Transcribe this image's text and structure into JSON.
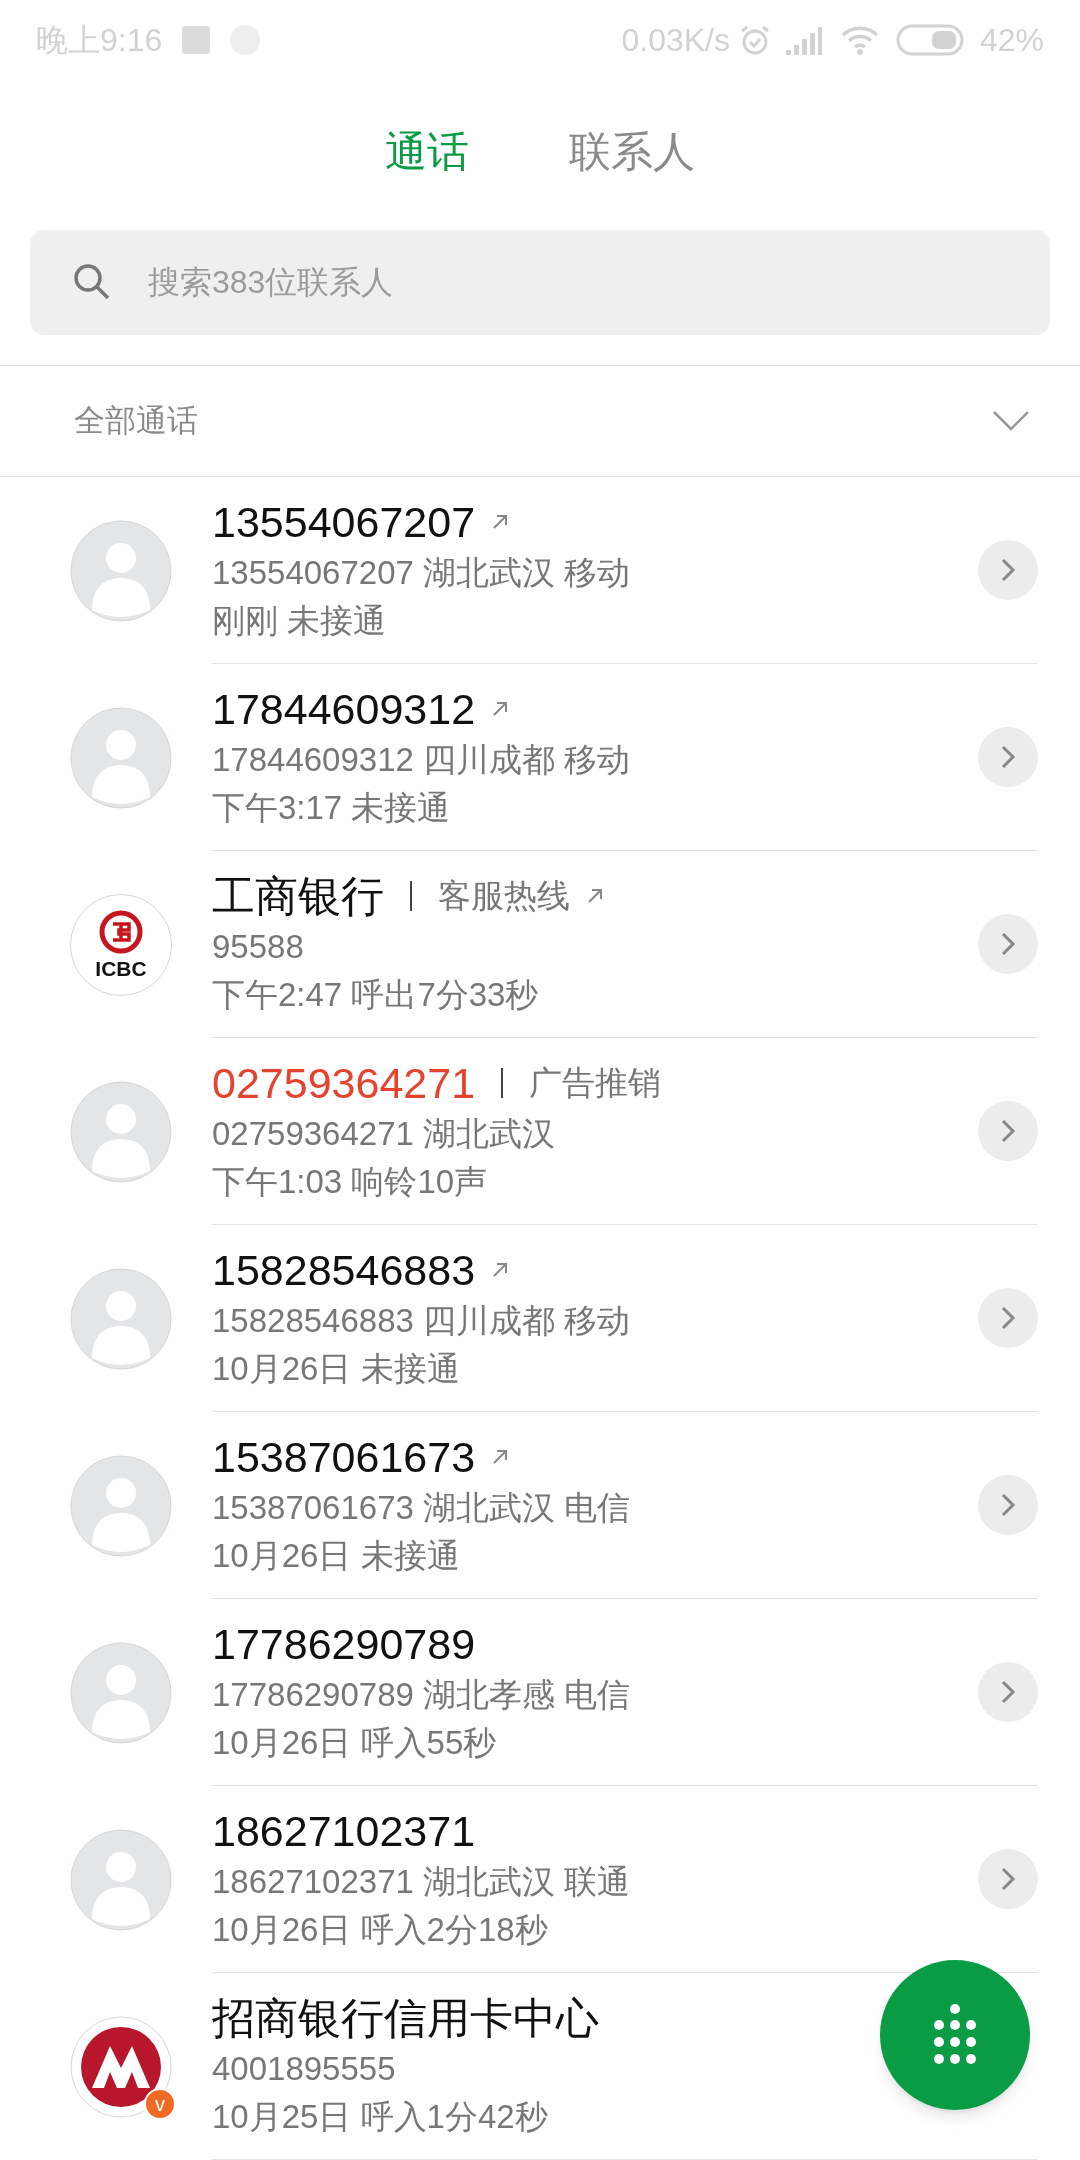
{
  "status_bar": {
    "time": "晚上9:16",
    "net_speed": "0.03K/s",
    "battery": "42%"
  },
  "tabs": [
    {
      "label": "通话",
      "selected": true
    },
    {
      "label": "联系人",
      "selected": false
    }
  ],
  "search": {
    "placeholder": "搜索383位联系人"
  },
  "filter": {
    "label": "全部通话"
  },
  "calls": [
    {
      "kind": "person",
      "name": "13554067207",
      "flagged": false,
      "outgoing": true,
      "detail": "13554067207 湖北武汉 移动",
      "time": "刚刚 未接通"
    },
    {
      "kind": "person",
      "name": "17844609312",
      "flagged": false,
      "outgoing": true,
      "detail": "17844609312 四川成都 移动",
      "time": "下午3:17 未接通"
    },
    {
      "kind": "icbc",
      "logo_text": "ICBC",
      "name": "工商银行",
      "tag": "客服热线",
      "flagged": false,
      "outgoing": true,
      "detail": "95588",
      "time": "下午2:47 呼出7分33秒"
    },
    {
      "kind": "person",
      "name": "02759364271",
      "tag": "广告推销",
      "flagged": true,
      "outgoing": false,
      "detail": "02759364271 湖北武汉",
      "time": "下午1:03 响铃10声"
    },
    {
      "kind": "person",
      "name": "15828546883",
      "flagged": false,
      "outgoing": true,
      "detail": "15828546883 四川成都 移动",
      "time": "10月26日 未接通"
    },
    {
      "kind": "person",
      "name": "15387061673",
      "flagged": false,
      "outgoing": true,
      "detail": "15387061673 湖北武汉 电信",
      "time": "10月26日 未接通"
    },
    {
      "kind": "person",
      "name": "17786290789",
      "flagged": false,
      "outgoing": false,
      "detail": "17786290789 湖北孝感 电信",
      "time": "10月26日 呼入55秒"
    },
    {
      "kind": "person",
      "name": "18627102371",
      "flagged": false,
      "outgoing": false,
      "detail": "18627102371 湖北武汉 联通",
      "time": "10月26日 呼入2分18秒"
    },
    {
      "kind": "cmb",
      "badge": "v",
      "name": "招商银行信用卡中心",
      "flagged": false,
      "outgoing": false,
      "detail": "4001895555",
      "time": "10月25日 呼入1分42秒"
    }
  ]
}
